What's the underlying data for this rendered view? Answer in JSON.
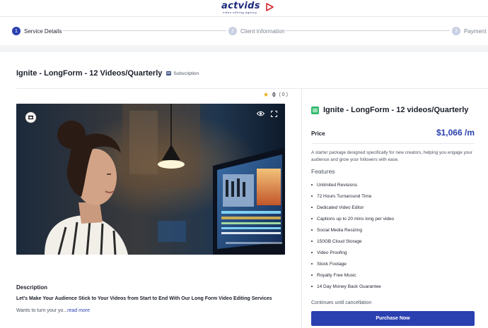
{
  "brand": {
    "logo_text": "actvids",
    "tagline": "video editing agency",
    "accent": "#2a3fb0"
  },
  "stepper": {
    "steps": [
      {
        "number": "1",
        "label": "Service Details",
        "state": "active"
      },
      {
        "number": "2",
        "label": "Client Information",
        "state": "inactive"
      },
      {
        "number": "3",
        "label": "Payment",
        "state": "inactive"
      }
    ]
  },
  "product": {
    "title": "Ignite - LongForm - 12 Videos/Quarterly",
    "badge": "Subscription",
    "rating": "0",
    "review_count": "( 0 )",
    "video_icons": {
      "logo": "film-reel-logo",
      "preview": "eye-icon",
      "fullscreen": "fullscreen-icon"
    }
  },
  "description": {
    "heading": "Description",
    "bold": "Let's Make Your Audience Stick to Your Videos from Start to End With Our Long Form Video Editing Services",
    "text": "Wants to turn your yo...",
    "read_more": "read more"
  },
  "panel": {
    "package_name": "Ignite - LongForm - 12 videos/Quarterly",
    "price_label": "Price",
    "price": "$1,066 /m",
    "blurb": "A starter package designed specifically for new creators, helping you engage your audience and grow your followers with ease.",
    "features_heading": "Features",
    "features": [
      "Unlimited Revisions",
      "72 Hours Turnaround Time",
      "Dedicated Video Editor",
      "Captions up to 20 mins long per video",
      "Social Media Resizing",
      "150GB Cloud Storage",
      "Video Proofing",
      "Stock Footage",
      "Royalty Free Music",
      "14 Day Money Back Guarantee"
    ],
    "continues": "Continues until cancellation",
    "cta": "Purchase Now"
  }
}
